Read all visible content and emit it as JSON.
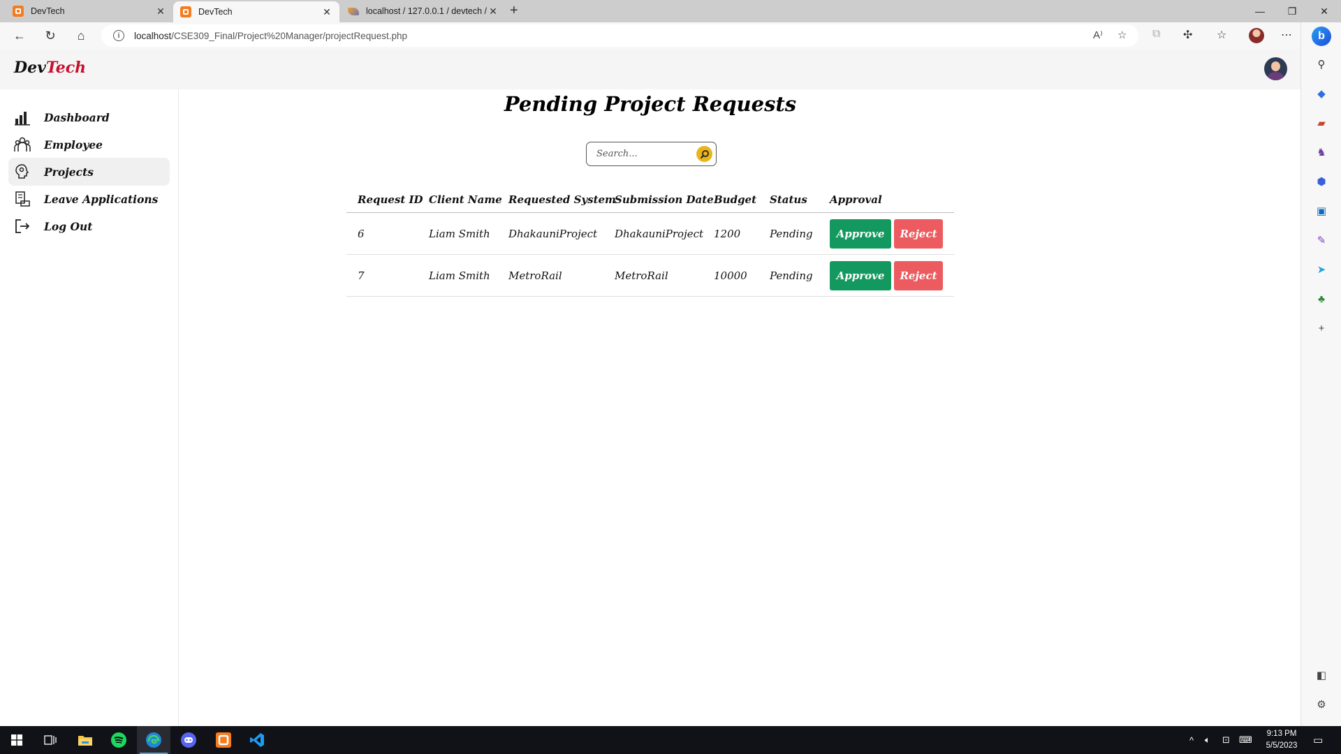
{
  "browser": {
    "tabs": [
      {
        "title": "DevTech",
        "favicon": "xampp-icon"
      },
      {
        "title": "DevTech",
        "favicon": "xampp-icon",
        "active": true
      },
      {
        "title": "localhost / 127.0.0.1 / devtech / t",
        "favicon": "phpmyadmin-icon"
      }
    ],
    "url_host": "localhost",
    "url_path": "/CSE309_Final/Project%20Manager/projectRequest.php"
  },
  "app": {
    "logo_dev": "Dev",
    "logo_tech": "Tech",
    "accent_color": "#c8102e"
  },
  "sidebar": {
    "items": [
      {
        "label": "Dashboard",
        "icon": "dashboard-icon"
      },
      {
        "label": "Employee",
        "icon": "employee-icon"
      },
      {
        "label": "Projects",
        "icon": "projects-icon",
        "active": true
      },
      {
        "label": "Leave Applications",
        "icon": "leave-icon"
      },
      {
        "label": "Log Out",
        "icon": "logout-icon"
      }
    ]
  },
  "main": {
    "title": "Pending Project Requests",
    "search_placeholder": "Search...",
    "columns": [
      "Request ID",
      "Client Name",
      "Requested System",
      "Submission Date",
      "Budget",
      "Status",
      "Approval"
    ],
    "rows": [
      {
        "id": "6",
        "client": "Liam Smith",
        "system": "DhakauniProject",
        "date": "DhakauniProject",
        "budget": "1200",
        "status": "Pending"
      },
      {
        "id": "7",
        "client": "Liam Smith",
        "system": "MetroRail",
        "date": "MetroRail",
        "budget": "10000",
        "status": "Pending"
      }
    ],
    "approve_label": "Approve",
    "reject_label": "Reject",
    "approve_color": "#13995f",
    "reject_color": "#ec5b5f"
  },
  "taskbar": {
    "time": "9:13 PM",
    "date": "5/5/2023"
  }
}
